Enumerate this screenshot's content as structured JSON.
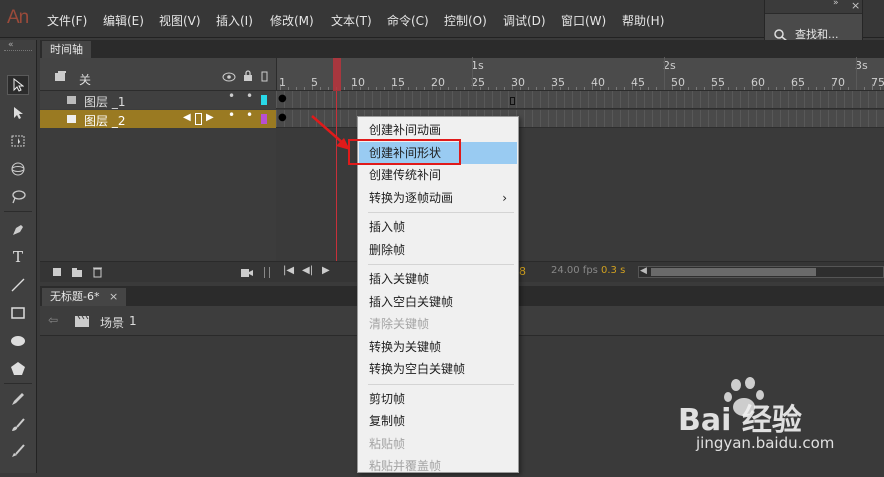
{
  "app": {
    "logo": "An"
  },
  "menu": [
    "文件(F)",
    "编辑(E)",
    "视图(V)",
    "插入(I)",
    "修改(M)",
    "文本(T)",
    "命令(C)",
    "控制(O)",
    "调试(D)",
    "窗口(W)",
    "帮助(H)"
  ],
  "find_panel": {
    "label": "查找和..."
  },
  "timeline": {
    "tab": "时间轴",
    "header_label": "关",
    "layers": [
      {
        "name": "图层 _1",
        "color": "#29d9e8",
        "selected": false
      },
      {
        "name": "图层 _2",
        "color": "#b84fd1",
        "selected": true
      }
    ],
    "ruler_numbers": [
      "1",
      "5",
      "10",
      "15",
      "20",
      "25",
      "30",
      "35",
      "40",
      "45",
      "50",
      "55",
      "60",
      "65",
      "70",
      "75"
    ],
    "ruler_seconds": [
      "1s",
      "2s",
      "3s"
    ],
    "footer": {
      "fps": "24.00 fps",
      "time": "0.3 s",
      "frame_partial": "8"
    }
  },
  "document": {
    "tab": "无标题-6*",
    "scene_label": "场景",
    "scene_number": "1"
  },
  "context_menu": [
    {
      "label": "创建补间动画",
      "disabled": false
    },
    {
      "label": "创建补间形状",
      "disabled": false,
      "highlighted": true
    },
    {
      "label": "创建传统补间",
      "disabled": false
    },
    {
      "label": "转换为逐帧动画",
      "disabled": false,
      "submenu": true
    },
    {
      "separator": true
    },
    {
      "label": "插入帧",
      "disabled": false
    },
    {
      "label": "删除帧",
      "disabled": false
    },
    {
      "separator": true
    },
    {
      "label": "插入关键帧",
      "disabled": false
    },
    {
      "label": "插入空白关键帧",
      "disabled": false
    },
    {
      "label": "清除关键帧",
      "disabled": true
    },
    {
      "label": "转换为关键帧",
      "disabled": false
    },
    {
      "label": "转换为空白关键帧",
      "disabled": false
    },
    {
      "separator": true
    },
    {
      "label": "剪切帧",
      "disabled": false
    },
    {
      "label": "复制帧",
      "disabled": false
    },
    {
      "label": "粘贴帧",
      "disabled": true
    },
    {
      "label": "粘贴并覆盖帧",
      "disabled": true
    }
  ],
  "watermark": {
    "text": "Bai  经验",
    "url": "jingyan.baidu.com"
  },
  "colors": {
    "accent_highlight": "#99cbf2",
    "playhead": "#c7303a",
    "selected_layer": "#9a7a22",
    "annotation_red": "#e01a1a"
  }
}
